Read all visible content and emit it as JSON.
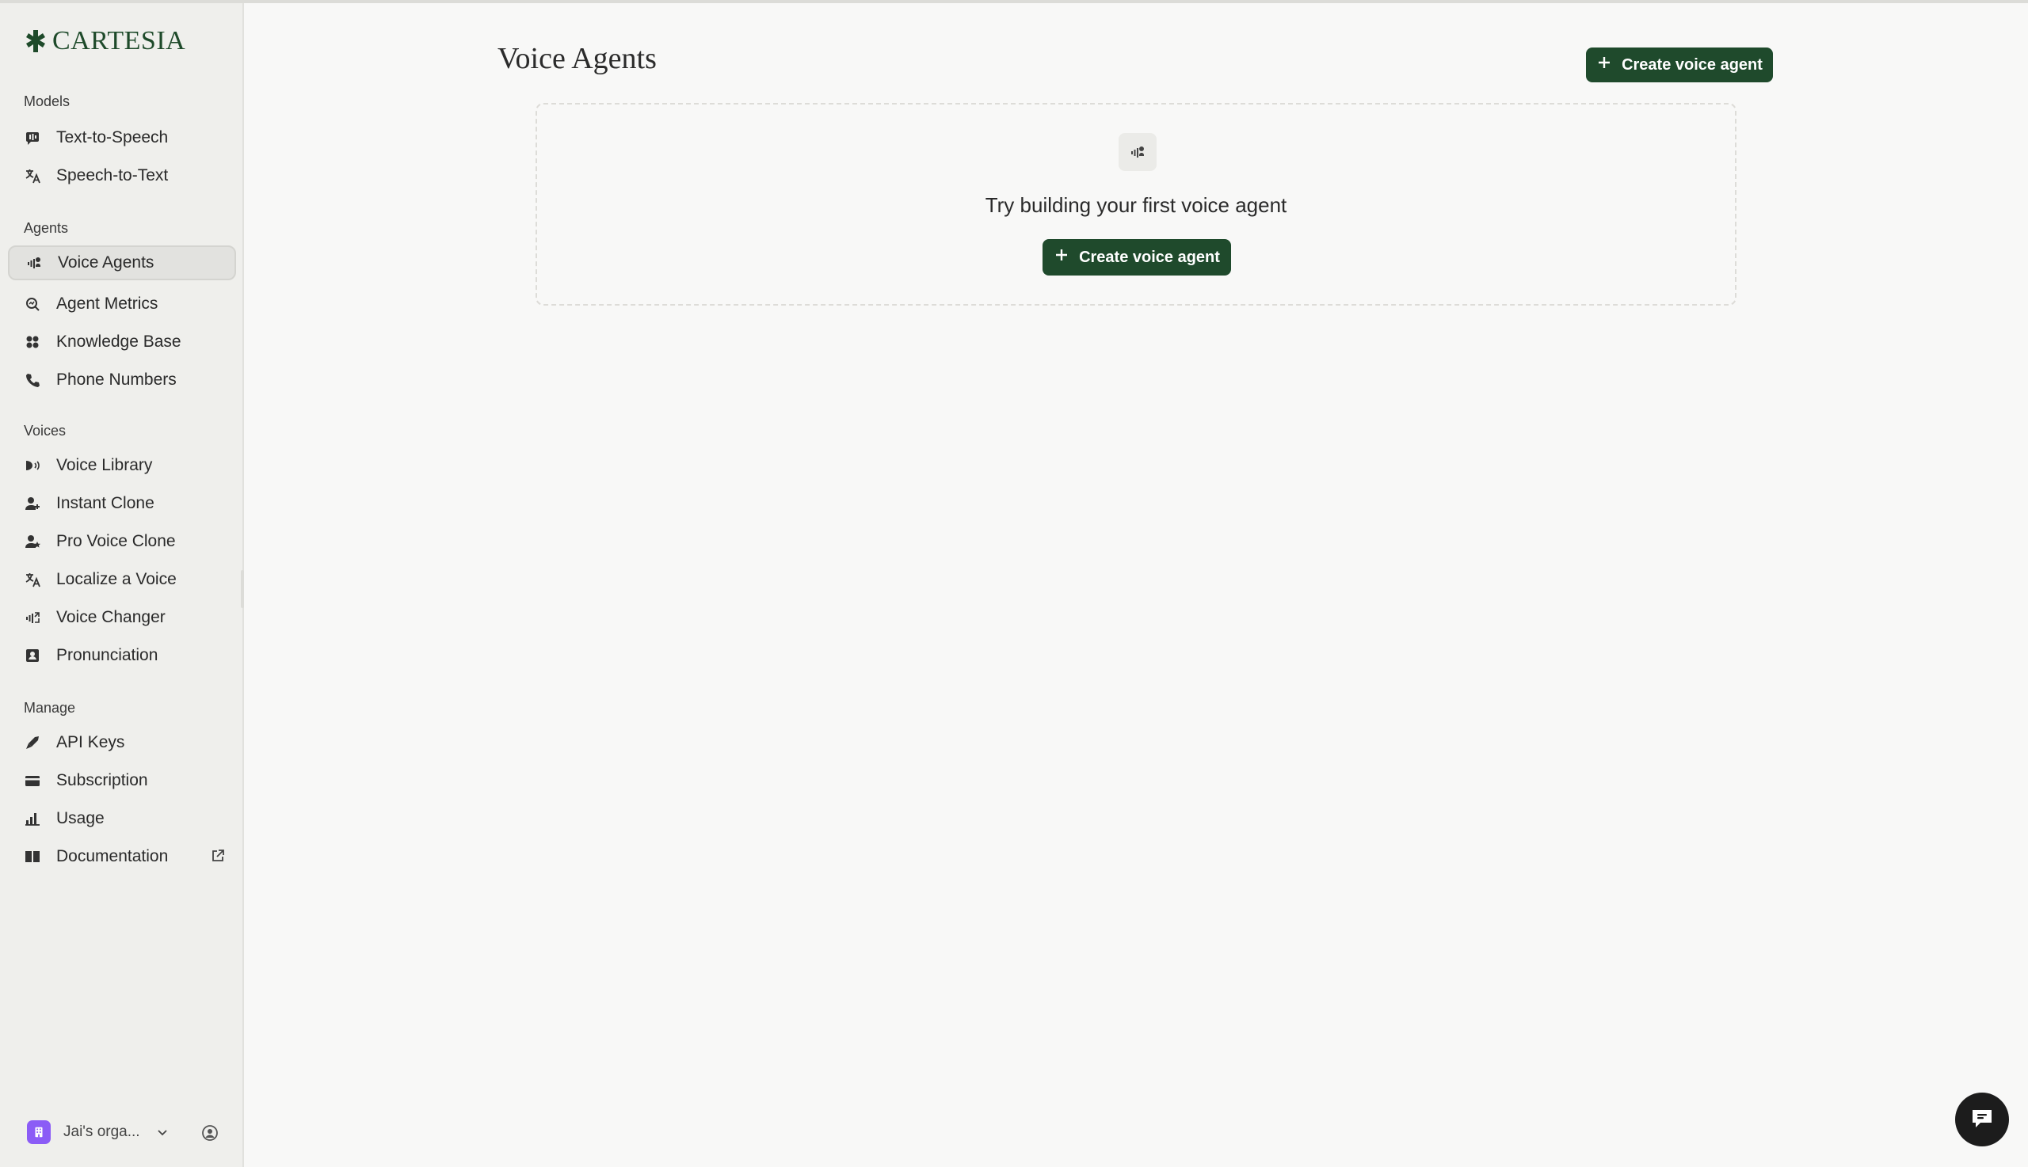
{
  "brand": {
    "name": "CARTESIA",
    "accent": "#1f4a2c"
  },
  "sidebar": {
    "sections": {
      "models": "Models",
      "agents": "Agents",
      "voices": "Voices",
      "manage": "Manage"
    },
    "items": {
      "tts": {
        "label": "Text-to-Speech",
        "icon": "text-to-speech-icon"
      },
      "stt": {
        "label": "Speech-to-Text",
        "icon": "translate-icon"
      },
      "voice_agents": {
        "label": "Voice Agents",
        "icon": "waveform-icon",
        "active": true
      },
      "agent_metrics": {
        "label": "Agent Metrics",
        "icon": "search-icon"
      },
      "knowledge_base": {
        "label": "Knowledge Base",
        "icon": "grid-icon"
      },
      "phone_numbers": {
        "label": "Phone Numbers",
        "icon": "phone-icon"
      },
      "voice_library": {
        "label": "Voice Library",
        "icon": "speaker-icon"
      },
      "instant_clone": {
        "label": "Instant Clone",
        "icon": "add-person-icon"
      },
      "pro_voice_clone": {
        "label": "Pro Voice Clone",
        "icon": "person-star-icon"
      },
      "localize_voice": {
        "label": "Localize a Voice",
        "icon": "translate-icon"
      },
      "voice_changer": {
        "label": "Voice Changer",
        "icon": "waveform-icon"
      },
      "pronunciation": {
        "label": "Pronunciation",
        "icon": "dictionary-icon"
      },
      "api_keys": {
        "label": "API Keys",
        "icon": "key-icon"
      },
      "subscription": {
        "label": "Subscription",
        "icon": "card-icon"
      },
      "usage": {
        "label": "Usage",
        "icon": "bar-chart-icon"
      },
      "documentation": {
        "label": "Documentation",
        "icon": "book-icon"
      }
    },
    "org": {
      "name": "Jai's orga..."
    }
  },
  "main": {
    "title": "Voice Agents",
    "create_button": "Create voice agent",
    "empty_state": {
      "title": "Try building your first voice agent",
      "button": "Create voice agent"
    }
  }
}
